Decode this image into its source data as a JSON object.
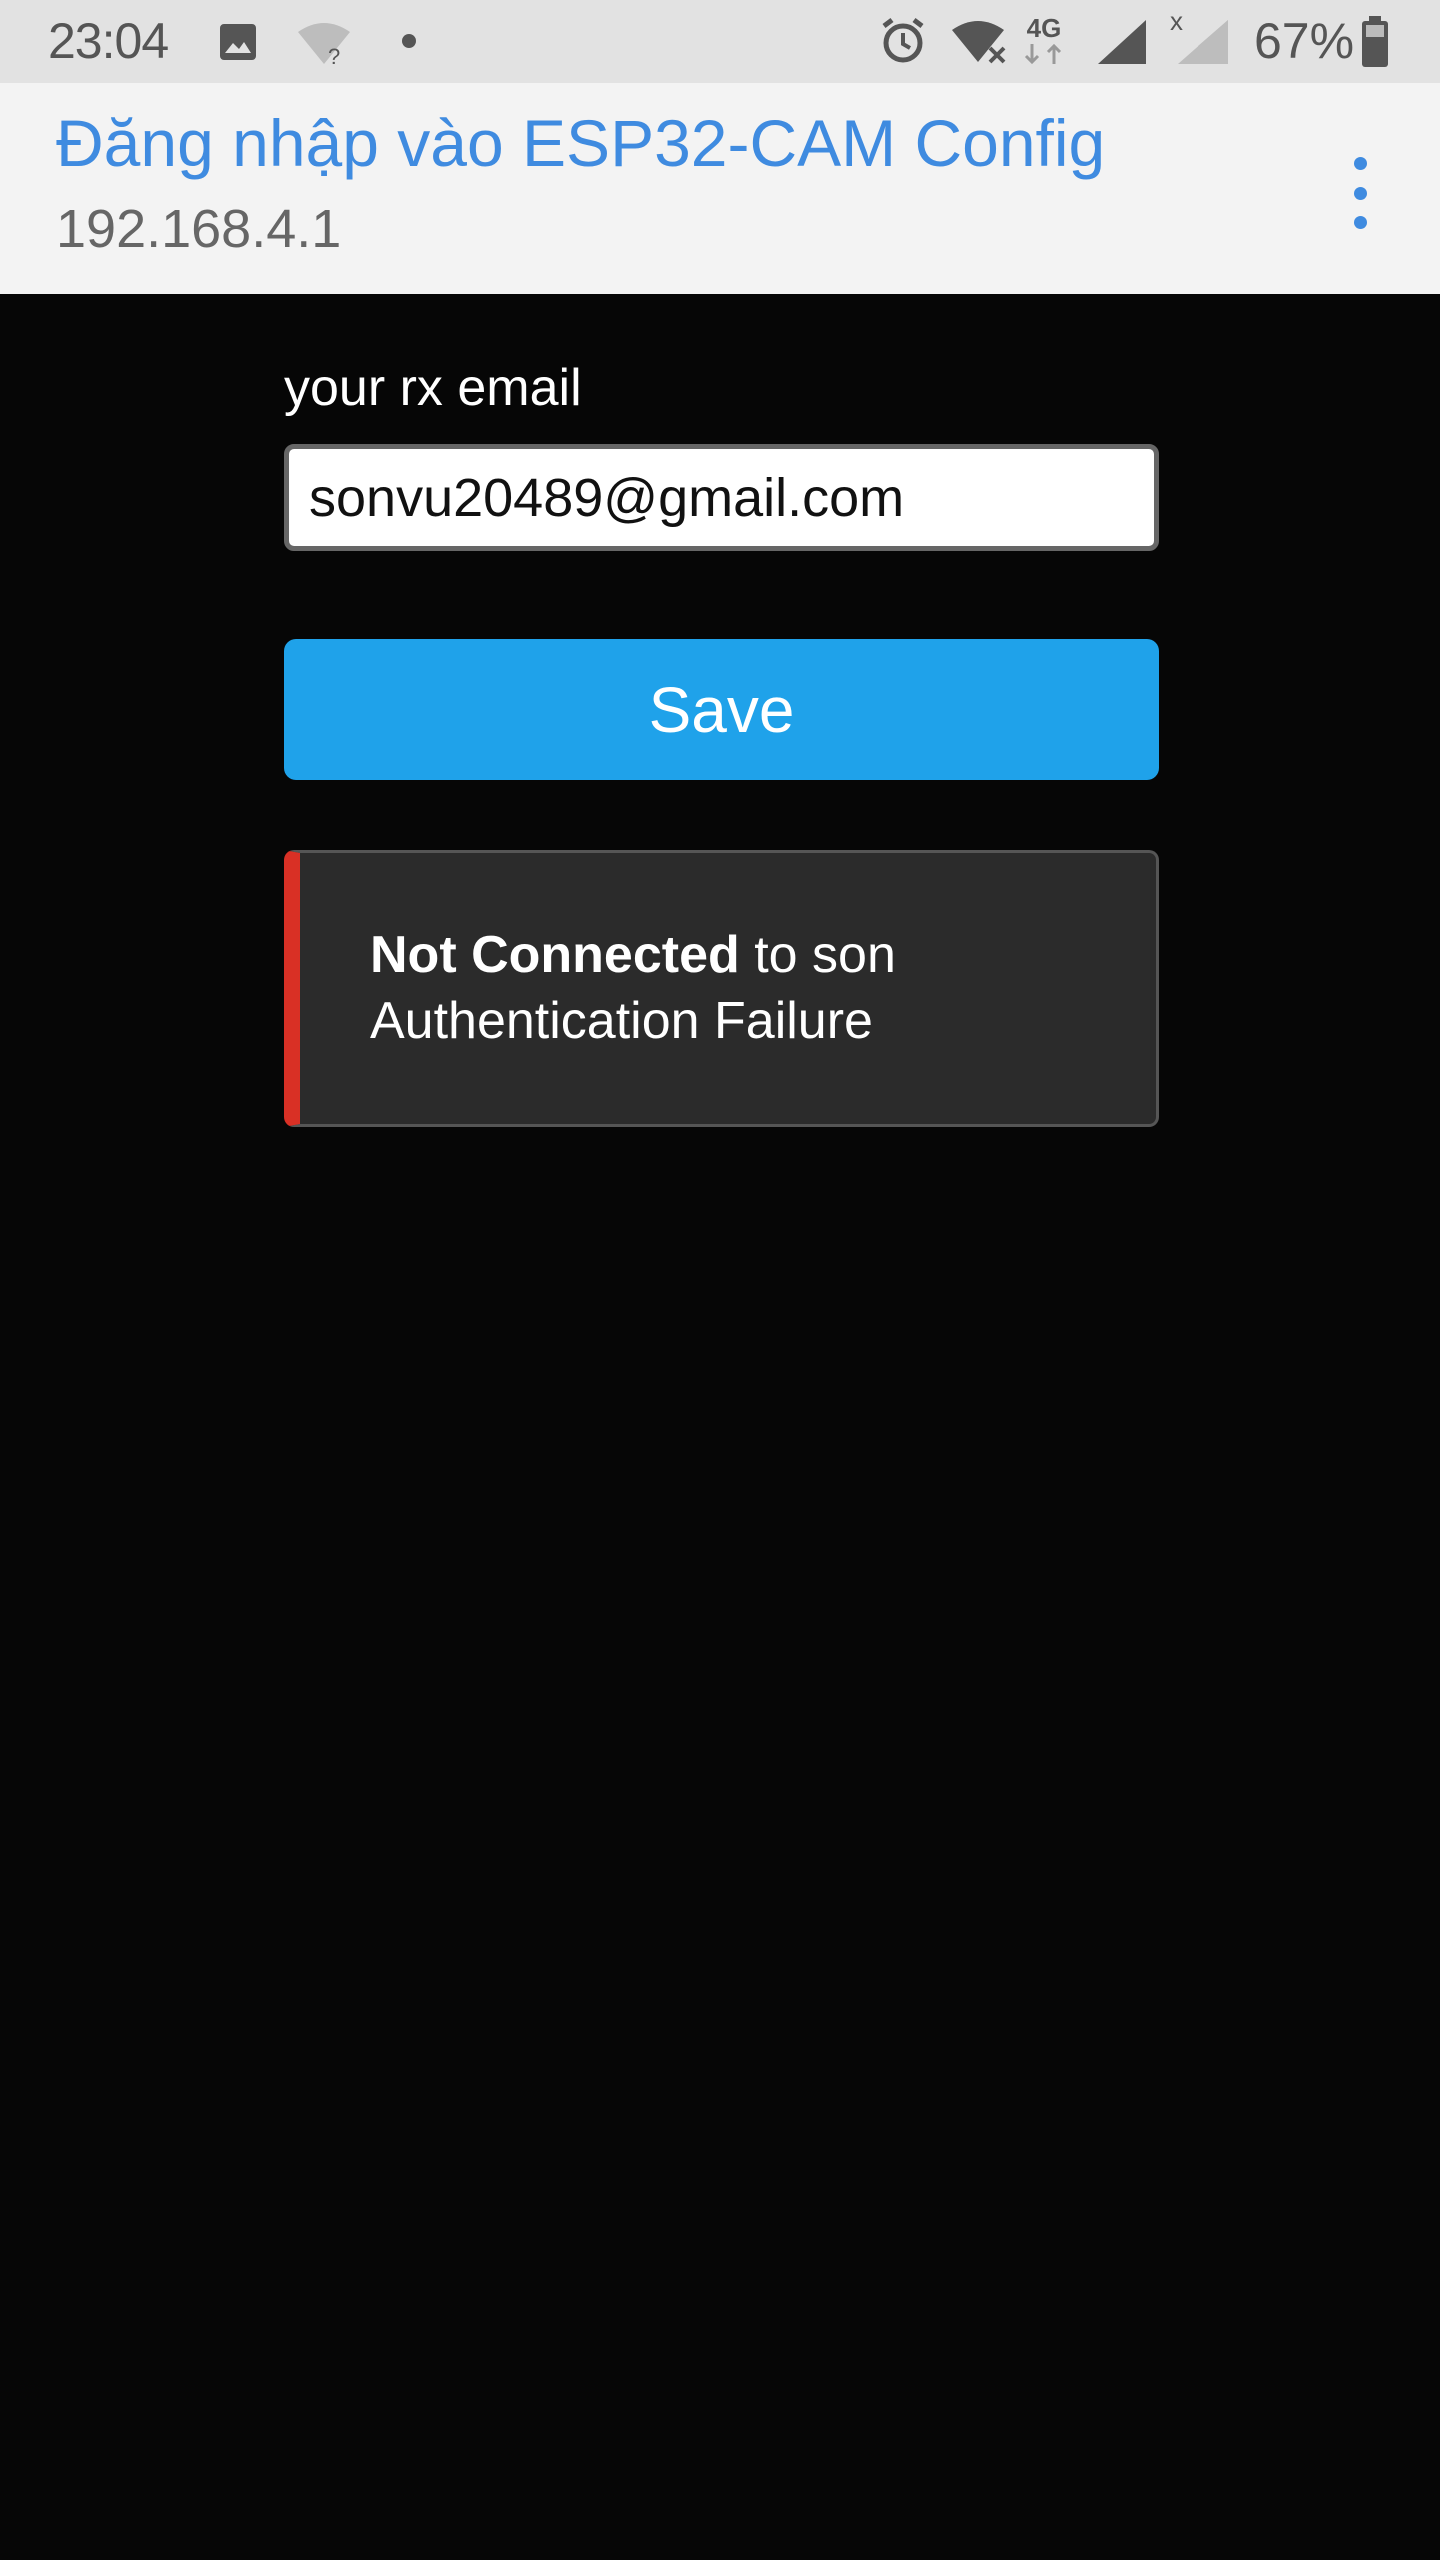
{
  "status_bar": {
    "time": "23:04",
    "battery_text": "67%",
    "network_label": "4G",
    "icons": [
      "image-icon",
      "wifi-question-icon",
      "dot-icon",
      "alarm-icon",
      "wifi-off-icon",
      "4g-data-icon",
      "cell-signal-icon",
      "cell-signal-x-icon",
      "battery-icon"
    ]
  },
  "app_bar": {
    "title": "Đăng nhập vào ESP32-CAM Config",
    "subtitle": "192.168.4.1",
    "menu_icon": "more-vert-icon"
  },
  "form": {
    "email_label": "your rx email",
    "email_value": "sonvu20489@gmail.com",
    "save_label": "Save"
  },
  "alert": {
    "status_strong": "Not Connected",
    "status_rest": " to son",
    "detail": "Authentication Failure"
  },
  "colors": {
    "accent": "#3f8be0",
    "button": "#1fa2ea",
    "alert_border": "#d93025",
    "background": "#060606"
  }
}
